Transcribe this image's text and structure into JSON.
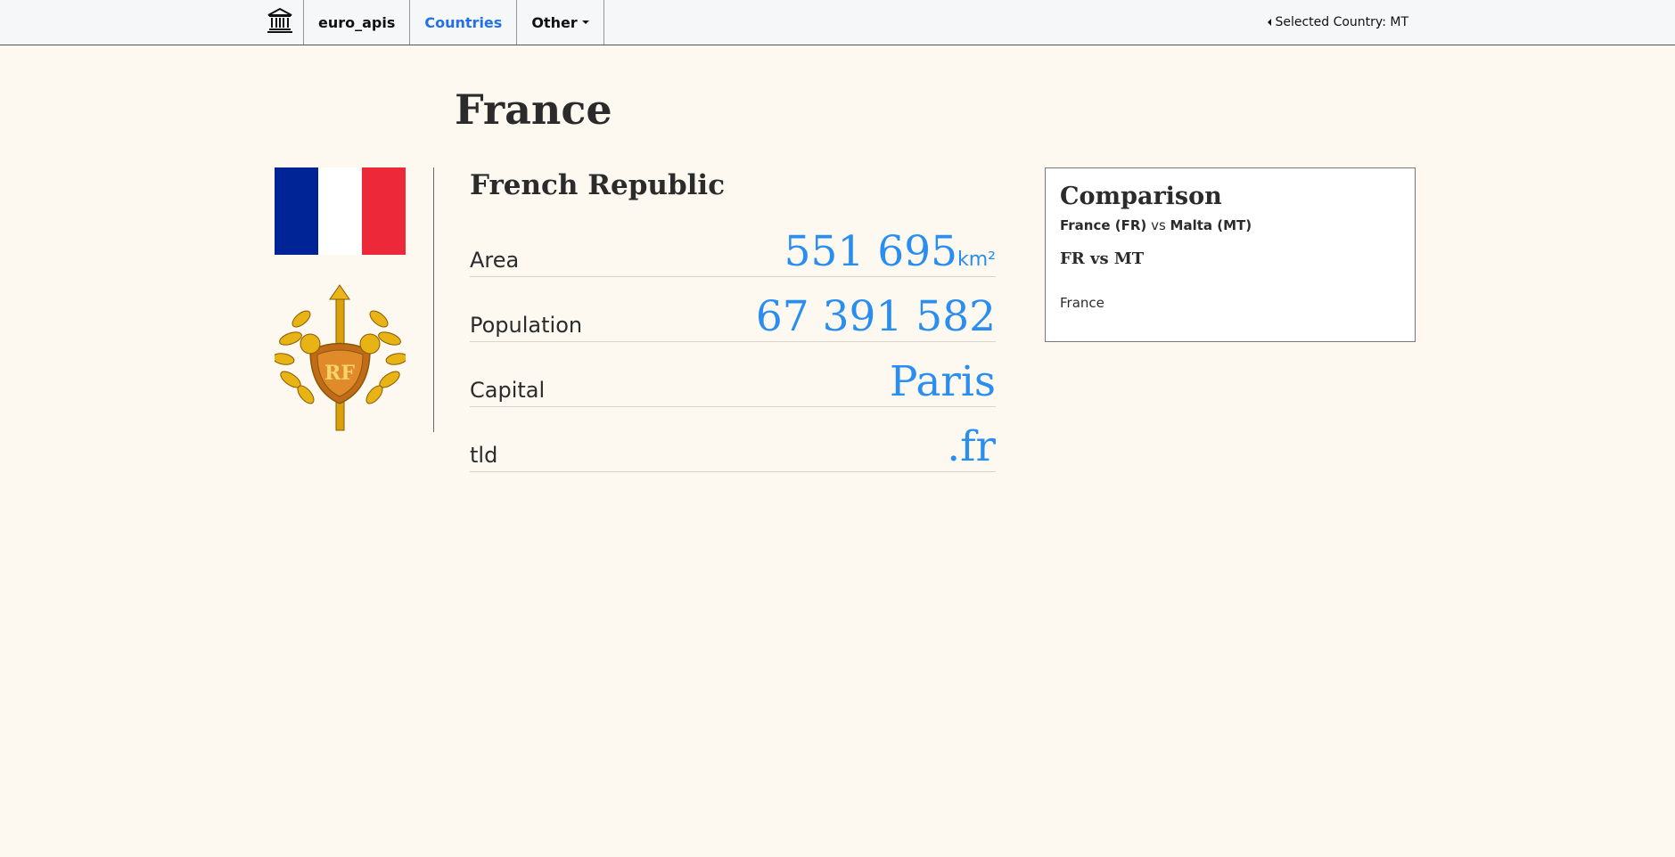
{
  "nav": {
    "brand": "euro_apis",
    "countries": "Countries",
    "other": "Other",
    "selected_country": "Selected Country: MT"
  },
  "page": {
    "title": "France",
    "official_name": "French Republic"
  },
  "facts": [
    {
      "label": "Area",
      "value": "551 695",
      "unit": "km²"
    },
    {
      "label": "Population",
      "value": "67 391 582"
    },
    {
      "label": "Capital",
      "value": "Paris"
    },
    {
      "label": "tld",
      "value": ".fr"
    }
  ],
  "comparison": {
    "title": "Comparison",
    "country_a": "France (FR)",
    "vs": "vs",
    "country_b": "Malta (MT)",
    "subtitle": "FR vs MT",
    "country": "France"
  },
  "colors": {
    "flag_blue": "#002395",
    "flag_white": "#ffffff",
    "flag_red": "#ed2939",
    "accent": "#2a8ef0",
    "nav_active": "#2271e8"
  }
}
